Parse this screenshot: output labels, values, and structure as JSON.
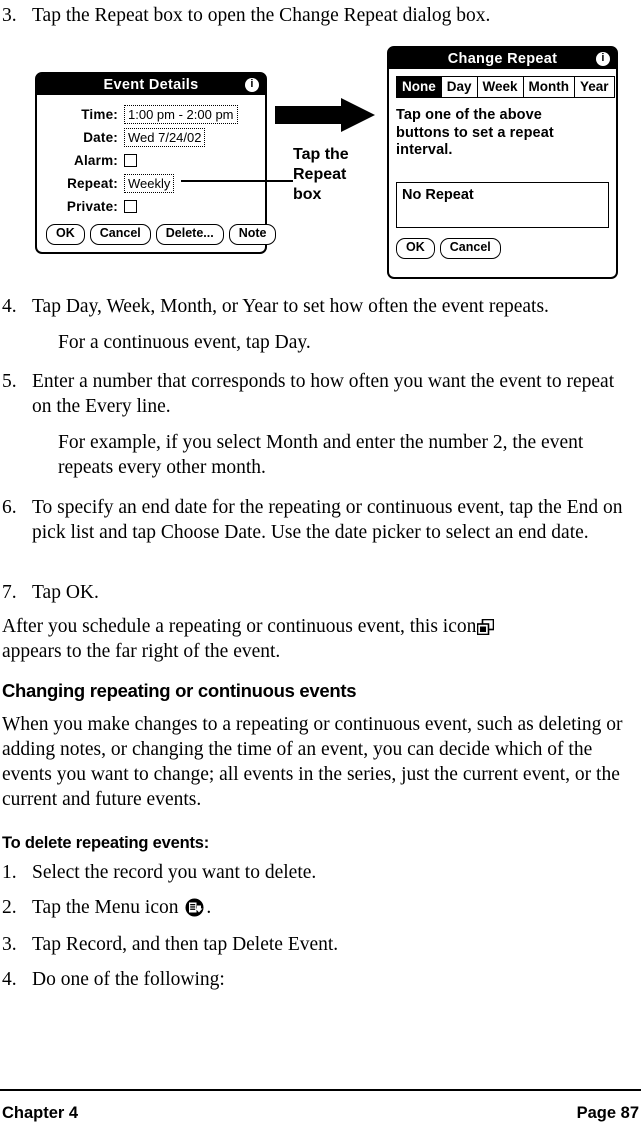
{
  "document": {
    "footer": {
      "left": "Chapter 4",
      "right": "Page 87"
    }
  },
  "steps_top": [
    {
      "num": "3.",
      "text": "Tap the Repeat box to open the Change Repeat dialog box."
    }
  ],
  "callout": {
    "line1": "Tap the",
    "line2": "Repeat",
    "line3": "box",
    "full_text": "Tap the Repeat box",
    "arrow": "right-arrow"
  },
  "event_details_dialog": {
    "title": "Event Details",
    "info_icon": "info-icon",
    "fields": [
      {
        "label": "Time:",
        "value": "1:00 pm - 2:00 pm",
        "type": "text"
      },
      {
        "label": "Date:",
        "value": "Wed 7/24/02",
        "type": "text"
      },
      {
        "label": "Alarm:",
        "value": "",
        "type": "checkbox",
        "checked": false
      },
      {
        "label": "Repeat:",
        "value": "Weekly",
        "type": "text"
      },
      {
        "label": "Private:",
        "value": "",
        "type": "checkbox",
        "checked": false
      }
    ],
    "buttons": [
      "OK",
      "Cancel",
      "Delete...",
      "Note"
    ]
  },
  "change_repeat_dialog": {
    "title": "Change Repeat",
    "info_icon": "info-icon",
    "tabs": [
      {
        "label": "None",
        "selected": true
      },
      {
        "label": "Day",
        "selected": false
      },
      {
        "label": "Week",
        "selected": false
      },
      {
        "label": "Month",
        "selected": false
      },
      {
        "label": "Year",
        "selected": false
      }
    ],
    "instruction": "Tap one of the above buttons to set a repeat interval.",
    "summary_box_value": "No Repeat",
    "buttons": [
      "OK",
      "Cancel"
    ]
  },
  "steps_middle": [
    {
      "num": "4.",
      "text": "Tap Day, Week, Month, or Year to set how often the event repeats."
    },
    {
      "num": "5.",
      "text": "Enter a number that corresponds to how often you want the event to repeat on the Every line."
    },
    {
      "num": "6.",
      "text": "To specify an end date for the repeating or continuous event, tap the End on pick list and tap Choose Date. Use the date picker to select an end date."
    },
    {
      "num": "7.",
      "text": "Tap OK."
    }
  ],
  "subtexts": {
    "after_step4": "For a continuous event, tap Day.",
    "after_step5": "For example, if you select Month and enter the number 2, the event repeats every other month."
  },
  "paragraphs": {
    "icon_note_before": "After you schedule a repeating or continuous event, this icon",
    "icon_note_after": "appears to the far right of the event.",
    "icon_note_icon": "repeat-icon",
    "changing_body": "When you make changes to a repeating or continuous event, such as deleting or adding notes, or changing the time of an event, you can decide which of the events you want to change; all events in the series, just the current event, or the current and future events."
  },
  "headings": {
    "changing": "Changing repeating or continuous events",
    "to_delete": "To delete repeating events:"
  },
  "steps_bottom": [
    {
      "num": "1.",
      "text": "Select the record you want to delete.",
      "has_icon": false
    },
    {
      "num": "2.",
      "text_before": "Tap the Menu icon",
      "text_after": ".",
      "icon": "menu-icon",
      "has_icon": true
    },
    {
      "num": "3.",
      "text": "Tap Record, and then tap Delete Event.",
      "has_icon": false
    },
    {
      "num": "4.",
      "text": "Do one of the following:",
      "has_icon": false
    }
  ],
  "colors": {
    "text": "#000000",
    "background": "#ffffff",
    "dialog_titlebar": "#000000",
    "dialog_titlebar_text": "#ffffff"
  }
}
